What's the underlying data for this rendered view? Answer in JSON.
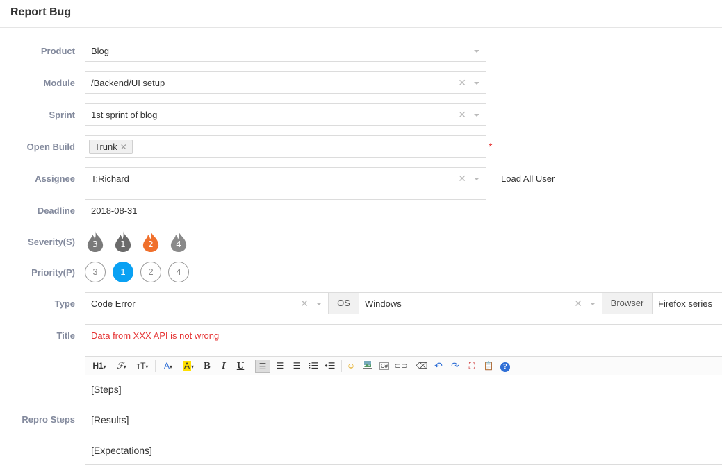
{
  "header": {
    "title": "Report Bug"
  },
  "form": {
    "product": {
      "label": "Product",
      "value": "Blog"
    },
    "module": {
      "label": "Module",
      "value": "/Backend/UI setup"
    },
    "sprint": {
      "label": "Sprint",
      "value": "1st sprint of blog"
    },
    "open_build": {
      "label": "Open Build",
      "chip": "Trunk",
      "required_mark": "*"
    },
    "assignee": {
      "label": "Assignee",
      "value": "T:Richard",
      "load_all_link": "Load All User"
    },
    "deadline": {
      "label": "Deadline",
      "value": "2018-08-31"
    },
    "severity": {
      "label": "Severity(S)",
      "options": [
        {
          "value": "3",
          "color": "#7a7a7a",
          "selected": false
        },
        {
          "value": "1",
          "color": "#6b6b6b",
          "selected": false
        },
        {
          "value": "2",
          "color": "#f0702c",
          "selected": true
        },
        {
          "value": "4",
          "color": "#8a8a8a",
          "selected": false
        }
      ]
    },
    "priority": {
      "label": "Priority(P)",
      "options": [
        {
          "value": "3",
          "selected": false
        },
        {
          "value": "1",
          "selected": true
        },
        {
          "value": "2",
          "selected": false
        },
        {
          "value": "4",
          "selected": false
        }
      ],
      "accent": "#0aa1f3"
    },
    "type": {
      "label": "Type",
      "value": "Code Error",
      "os_label": "OS",
      "os_value": "Windows",
      "browser_label": "Browser",
      "browser_value": "Firefox series"
    },
    "title": {
      "label": "Title",
      "value": "Data from XXX API is not wrong",
      "color": "#e53333"
    },
    "repro_steps": {
      "label": "Repro Steps",
      "toolbar": [
        "heading-icon",
        "font-family-icon",
        "font-size-icon",
        "font-color-icon",
        "highlight-icon",
        "bold-icon",
        "italic-icon",
        "underline-icon",
        "align-left-icon",
        "align-center-icon",
        "align-right-icon",
        "ordered-list-icon",
        "unordered-list-icon",
        "emoticon-icon",
        "image-icon",
        "code-icon",
        "link-icon",
        "clear-format-icon",
        "undo-icon",
        "redo-icon",
        "fullscreen-icon",
        "paste-icon",
        "help-icon"
      ],
      "lines": [
        "[Steps]",
        "[Results]",
        "[Expectations]"
      ]
    }
  }
}
